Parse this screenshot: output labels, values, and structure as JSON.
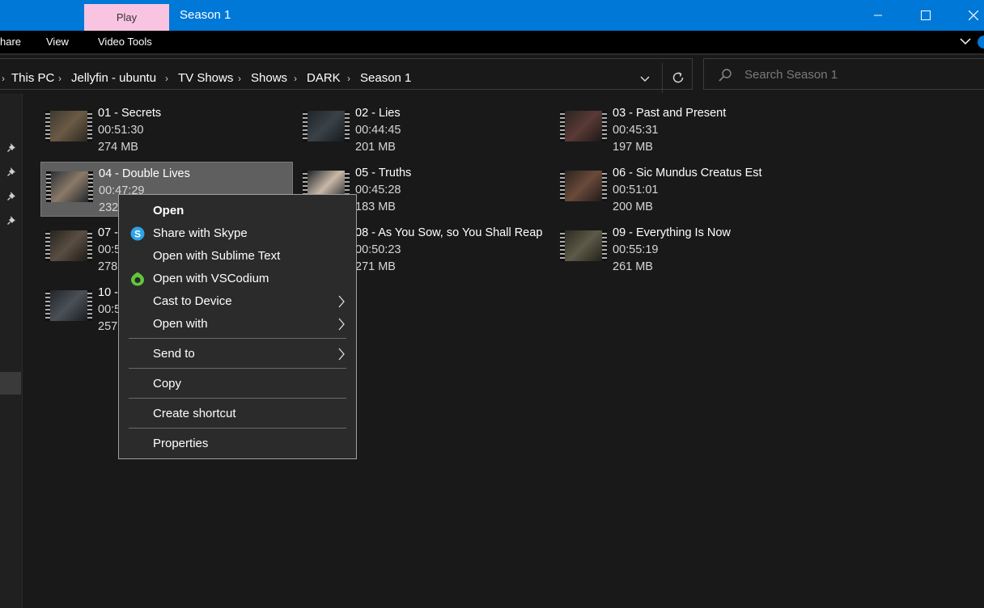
{
  "window": {
    "title": "Season 1",
    "contextual_tab": "Play",
    "accent_color": "#0078d7",
    "contextual_tab_color": "#f9c4e1"
  },
  "ribbon": {
    "tabs": [
      "hare",
      "View",
      "Video Tools"
    ]
  },
  "address": {
    "crumbs": [
      "This PC",
      "Jellyfin - ubuntu",
      "TV Shows",
      "Shows",
      "DARK",
      "Season 1"
    ]
  },
  "search": {
    "placeholder": "Search Season 1"
  },
  "files": [
    {
      "name": "01 - Secrets",
      "duration": "00:51:30",
      "size": "274 MB"
    },
    {
      "name": "02 - Lies",
      "duration": "00:44:45",
      "size": "201 MB"
    },
    {
      "name": "03 - Past and Present",
      "duration": "00:45:31",
      "size": "197 MB"
    },
    {
      "name": "04 - Double Lives",
      "duration": "00:47:29",
      "size": "232",
      "selected": true
    },
    {
      "name": "05 - Truths",
      "duration": "00:45:28",
      "size": "183 MB"
    },
    {
      "name": "06 - Sic Mundus Creatus Est",
      "duration": "00:51:01",
      "size": "200 MB"
    },
    {
      "name": "07 -",
      "duration": "00:5",
      "size": "278"
    },
    {
      "name": "08 - As You Sow, so You Shall Reap",
      "duration": "00:50:23",
      "size": "271 MB"
    },
    {
      "name": "09 - Everything Is Now",
      "duration": "00:55:19",
      "size": "261 MB"
    },
    {
      "name": "10 -",
      "duration": "00:5",
      "size": "257"
    }
  ],
  "context_menu": {
    "items": [
      {
        "label": "Open",
        "bold": true
      },
      {
        "label": "Share with Skype",
        "icon": "skype-icon"
      },
      {
        "label": "Open with Sublime Text"
      },
      {
        "label": "Open with VSCodium",
        "icon": "vscodium-icon"
      },
      {
        "label": "Cast to Device",
        "submenu": true
      },
      {
        "label": "Open with",
        "submenu": true
      },
      {
        "label": "Send to",
        "submenu": true
      },
      {
        "label": "Copy"
      },
      {
        "label": "Create shortcut"
      },
      {
        "label": "Properties"
      }
    ]
  }
}
